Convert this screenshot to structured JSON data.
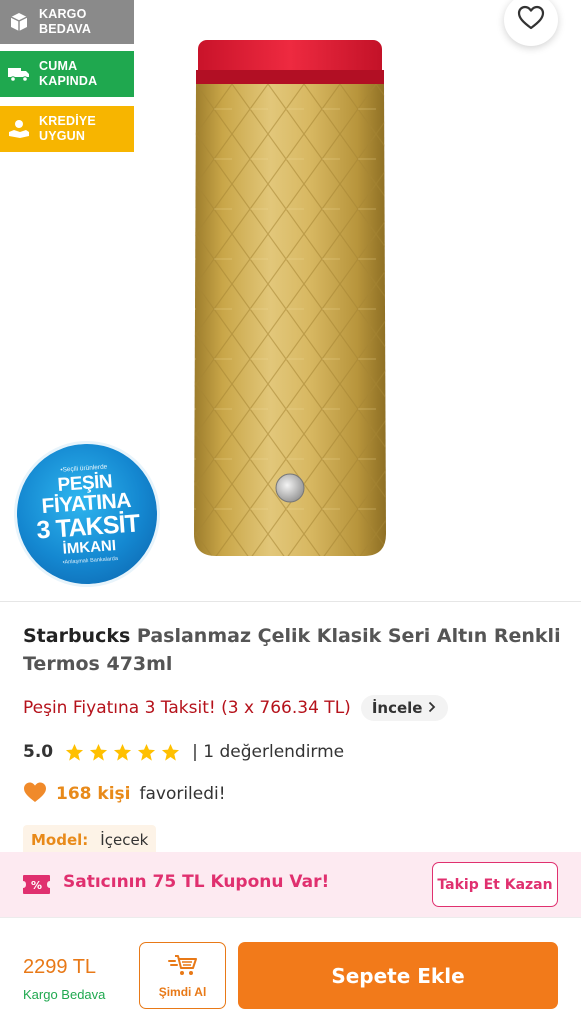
{
  "badges": {
    "cargo": {
      "line1": "KARGO",
      "line2": "BEDAVA",
      "icon": "box-icon",
      "color": "#8a8a8a"
    },
    "friday": {
      "line1": "CUMA",
      "line2": "KAPINDA",
      "icon": "truck-icon",
      "color": "#1fa84f"
    },
    "credit": {
      "line1": "KREDİYE",
      "line2": "UYGUN",
      "icon": "money-hand-icon",
      "color": "#f7b500"
    }
  },
  "promo_sticker": {
    "top": "•Seçili ürünlerde",
    "line1": "PEŞİN",
    "line2": "FİYATINA",
    "line3": "3 TAKSİT",
    "line4": "İMKANI",
    "bottom": "•Anlaşmalı Bankalarda"
  },
  "product": {
    "brand": "Starbucks",
    "name": "Paslanmaz Çelik Klasik Seri Altın Renkli Termos 473ml",
    "installment_text": "Peşin Fiyatına 3 Taksit! (3 x 766.34 TL)",
    "inspect_label": "İncele",
    "rating": "5.0",
    "stars": 5,
    "review_count": "| 1 değerlendirme",
    "favorite_count": "168 kişi",
    "favorite_text": "favoriledi!",
    "model_label": "Model:",
    "model_value": "İçecek"
  },
  "coupon": {
    "text": "Satıcının 75 TL Kuponu Var!",
    "button": "Takip Et Kazan",
    "color": "#e0306f"
  },
  "bottom_bar": {
    "price": "2299 TL",
    "shipping": "Kargo Bedava",
    "buy_now_label": "Şimdi Al",
    "add_to_cart_label": "Sepete Ekle",
    "accent": "#f27a1a"
  }
}
